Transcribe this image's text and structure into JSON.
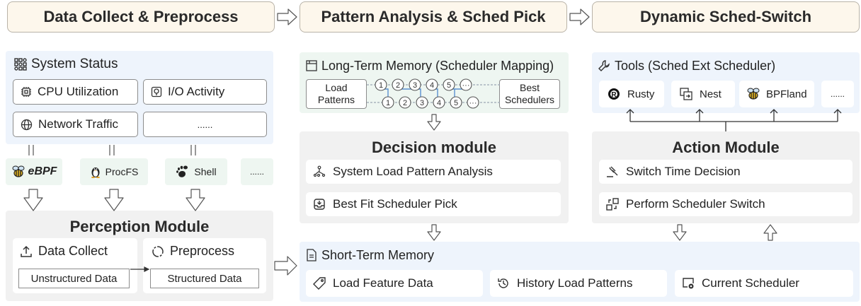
{
  "phases": [
    "Data Collect & Preprocess",
    "Pattern Analysis & Sched Pick",
    "Dynamic Sched-Switch"
  ],
  "system_status": {
    "title": "System Status",
    "items": [
      "CPU Utilization",
      "I/O Activity",
      "Network Traffic",
      "......"
    ]
  },
  "sources": [
    "eBPF",
    "ProcFS",
    "Shell",
    "......"
  ],
  "perception": {
    "title": "Perception Module",
    "collect": "Data Collect",
    "preprocess": "Preprocess",
    "unstructured": "Unstructured Data",
    "structured": "Structured Data"
  },
  "long_term": {
    "title": "Long-Term Memory (Scheduler Mapping)",
    "left_label": "Load\nPatterns",
    "right_label": "Best\nSchedulers",
    "nodes": [
      "1",
      "2",
      "3",
      "4",
      "5",
      "···"
    ]
  },
  "decision": {
    "title": "Decision module",
    "items": [
      "System Load Pattern Analysis",
      "Best Fit Scheduler Pick"
    ]
  },
  "tools": {
    "title": "Tools (Sched Ext Scheduler)",
    "items": [
      "Rusty",
      "Nest",
      "BPFland",
      "......"
    ]
  },
  "action": {
    "title": "Action Module",
    "items": [
      "Switch Time Decision",
      "Perform Scheduler Switch"
    ]
  },
  "short_term": {
    "title": "Short-Term Memory",
    "items": [
      "Load Feature Data",
      "History Load  Patterns",
      "Current Scheduler"
    ]
  }
}
